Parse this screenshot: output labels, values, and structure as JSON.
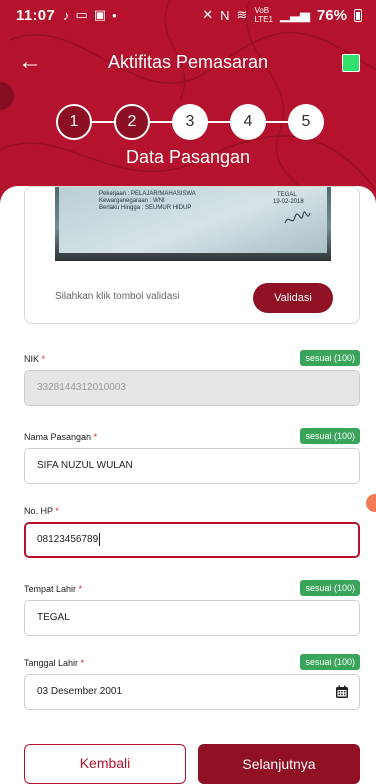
{
  "status_bar": {
    "time": "11:07",
    "left_icons": [
      "music-note-icon",
      "cast-icon",
      "app-badge-icon",
      "dot-icon"
    ],
    "right_icons": [
      "mute-icon",
      "nfc-icon",
      "wifi-icon",
      "volte-icon",
      "signal-icon",
      "signal-icon"
    ],
    "volte_label": "VoB LTE1",
    "battery": "76%"
  },
  "appbar": {
    "title": "Aktifitas Pemasaran"
  },
  "stepper": {
    "steps": [
      "1",
      "2",
      "3",
      "4",
      "5"
    ],
    "completed": 2
  },
  "section_title": "Data Pasangan",
  "ktp_card": {
    "lines": [
      "Pekerjaan          : PELAJAR/MAHASISWA",
      "Kewarganegaraan : WNI",
      "Berlaku Hingga    : SEUMUR HIDUP"
    ],
    "city": "TEGAL",
    "date": "19-02-2018",
    "hint": "Silahkan klik tombol validasi",
    "validate_label": "Validasi"
  },
  "fields": {
    "nik": {
      "label": "NIK",
      "required": "*",
      "value": "3328144312010003",
      "badge": "sesuai (100)"
    },
    "nama_pasangan": {
      "label": "Nama Pasangan",
      "required": "*",
      "value": "SIFA NUZUL WULAN",
      "badge": "sesuai (100)"
    },
    "no_hp": {
      "label": "No. HP",
      "required": "*",
      "value": "08123456789"
    },
    "tempat_lahir": {
      "label": "Tempat Lahir",
      "required": "*",
      "value": "TEGAL",
      "badge": "sesuai (100)"
    },
    "tanggal_lahir": {
      "label": "Tanggal Lahir",
      "required": "*",
      "value": "03 Desember 2001",
      "badge": "sesuai (100)"
    }
  },
  "buttons": {
    "back": "Kembali",
    "next": "Selanjutnya"
  },
  "colors": {
    "brand": "#b5122d",
    "brand_dark": "#8f1123",
    "badge_green": "#3aa55a",
    "status_green": "#33e06b"
  }
}
